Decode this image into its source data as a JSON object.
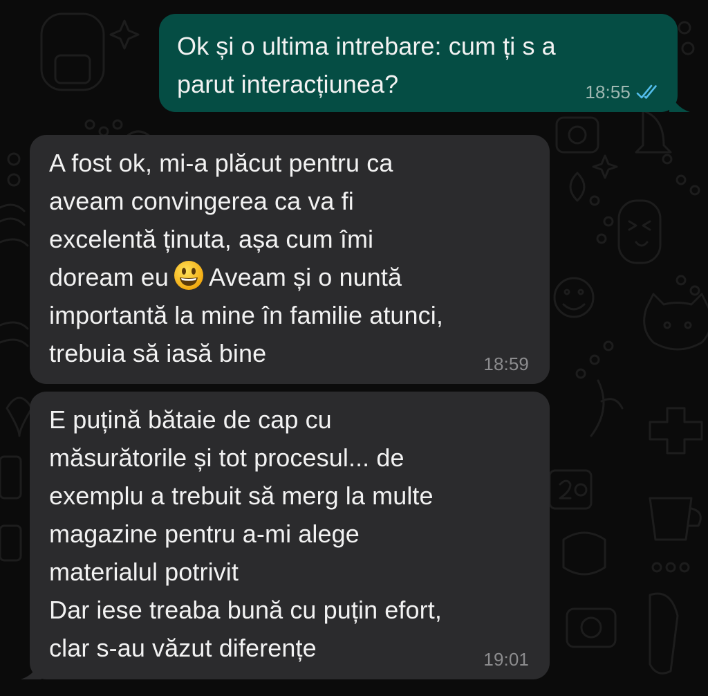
{
  "chat": {
    "colors": {
      "background": "#0b0b0b",
      "outgoing_bubble": "#054d44",
      "incoming_bubble": "#2b2b2d",
      "text": "#f2f2f2",
      "timestamp": "#8c8c8e",
      "read_receipt": "#53bdeb"
    },
    "messages": [
      {
        "direction": "outgoing",
        "text": "Ok și o ultima intrebare: cum ți s a\nparut interacțiunea?",
        "time": "18:55",
        "status_icon": "double-check-read-icon"
      },
      {
        "direction": "incoming",
        "text_before_emoji": "A fost ok, mi-a plăcut pentru ca\naveam convingerea ca va fi\nexcelentă ținuta, așa cum îmi\ndoream eu",
        "emoji": "grinning-face-icon",
        "text_after_emoji": "Aveam și o nuntă\nimportantă la mine în familie atunci,\ntrebuia să iasă bine",
        "time": "18:59"
      },
      {
        "direction": "incoming",
        "text": "E puțină bătaie de cap cu\nmăsurătorile și tot procesul... de\nexemplu a trebuit să merg la multe\nmagazine pentru a-mi alege\nmaterialul potrivit\nDar iese treaba bună cu puțin efort,\nclar s-au văzut diferențe",
        "time": "19:01"
      }
    ]
  }
}
